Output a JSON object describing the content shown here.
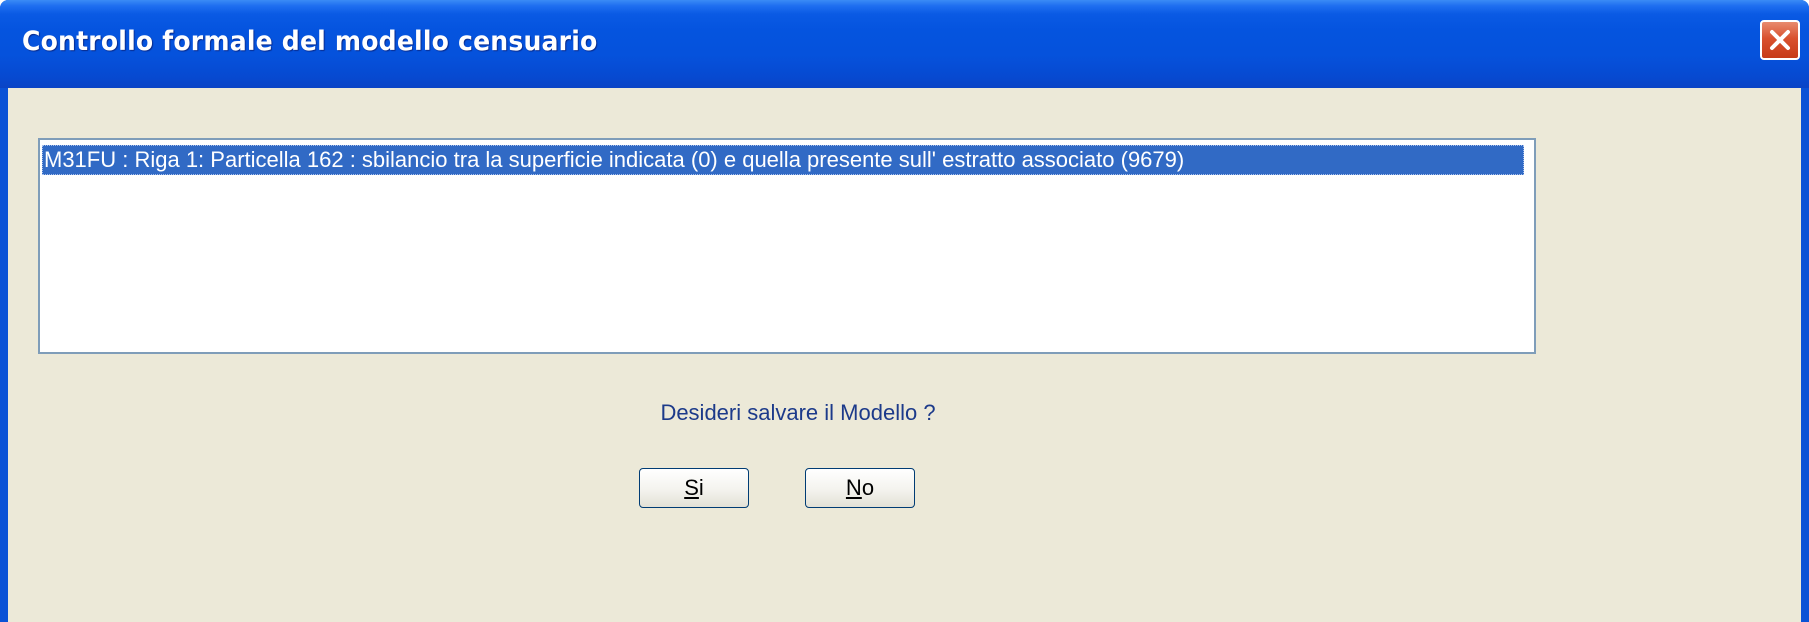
{
  "window": {
    "title": "Controllo formale del modello censuario",
    "close_icon": "close-icon"
  },
  "list": {
    "items": [
      {
        "text": "M31FU : Riga 1: Particella 162 : sbilancio tra la superficie indicata (0) e quella presente sull' estratto associato (9679)",
        "selected": true
      }
    ]
  },
  "prompt": {
    "text": "Desideri salvare il Modello ?"
  },
  "buttons": {
    "yes": {
      "mnemonic": "S",
      "rest": "i"
    },
    "no": {
      "mnemonic": "N",
      "rest": "o"
    }
  },
  "colors": {
    "titlebar": "#0554df",
    "selection": "#316ac5",
    "dialog_background": "#ece9d8",
    "close_button": "#d9522f"
  }
}
